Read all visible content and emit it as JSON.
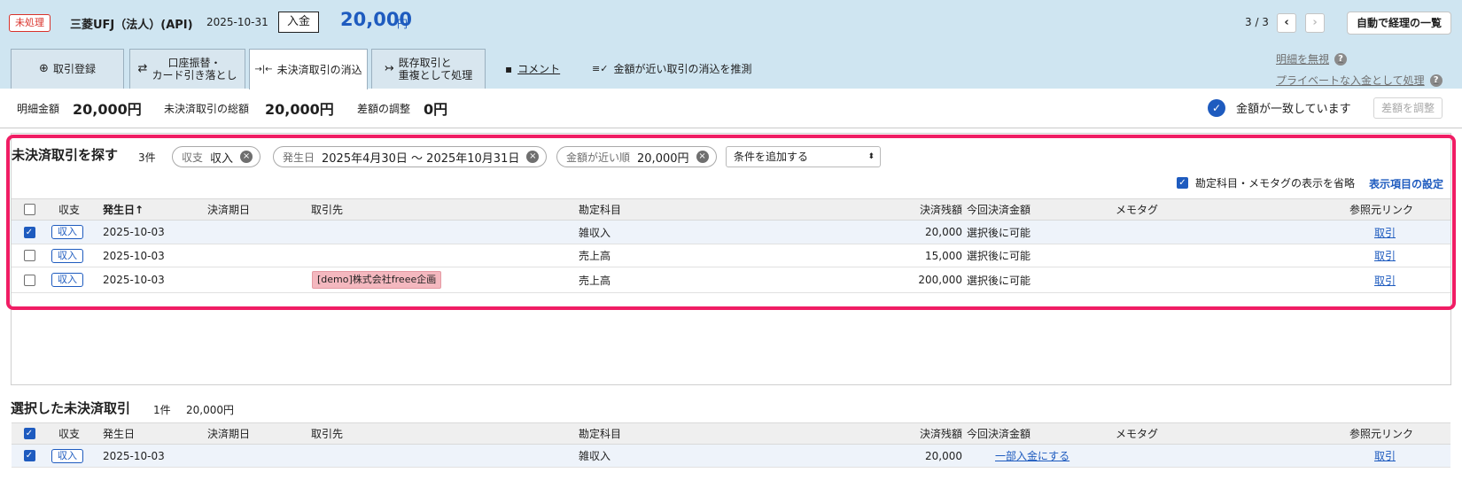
{
  "header": {
    "status_badge": "未処理",
    "bank_name": "三菱UFJ（法人）(API)",
    "date": "2025-10-31",
    "type": "入金",
    "amount": "20,000",
    "amount_unit": "円",
    "pager": "3 / 3",
    "prev_glyph": "‹",
    "next_glyph": "›",
    "auto_list_label": "自動で経理の一覧"
  },
  "tabs": [
    {
      "label": "取引登録",
      "icon": "⊕"
    },
    {
      "label1": "口座振替・",
      "label2": "カード引き落とし",
      "icon": "⇄"
    },
    {
      "label": "未決済取引の消込",
      "icon": "→|←"
    },
    {
      "label1": "既存取引と",
      "label2": "重複として処理",
      "icon": "↣"
    }
  ],
  "links": {
    "comment": "コメント",
    "comment_icon": "▪",
    "suggest": "金額が近い取引の消込を推測",
    "suggest_icon": "≡✓",
    "ignore": "明細を無視",
    "private_income": "プライベートな入金として処理",
    "help_glyph": "?"
  },
  "summary": {
    "detail_label": "明細金額",
    "detail_value": "20,000円",
    "unsettled_total_label": "未決済取引の総額",
    "unsettled_total_value": "20,000円",
    "diff_label": "差額の調整",
    "diff_value": "0円",
    "match_text": "金額が一致しています",
    "match_glyph": "✓",
    "adjust_label": "差額を調整"
  },
  "search": {
    "title": "未決済取引を探す",
    "count": "3件",
    "chips": [
      {
        "key": "収支",
        "value": "収入"
      },
      {
        "key": "発生日",
        "value": "2025年4月30日 ～ 2025年10月31日"
      },
      {
        "key": "金額が近い順",
        "value": "20,000円"
      }
    ],
    "chip_remove_glyph": "×",
    "add_condition": "条件を追加する",
    "select_arrow": "⬍",
    "omit_label": "勘定科目・メモタグの表示を省略",
    "display_settings": "表示項目の設定",
    "check_glyph": "✓",
    "columns": {
      "type": "収支",
      "date": "発生日",
      "sort_glyph": "↑",
      "due": "決済期日",
      "partner": "取引先",
      "account": "勘定科目",
      "balance": "決済残額",
      "current": "今回決済金額",
      "memo": "メモタグ",
      "ref": "参照元リンク"
    },
    "rows": [
      {
        "type": "収入",
        "date": "2025-10-03",
        "partner": "",
        "account": "雑収入",
        "balance": "20,000",
        "current": "選択後に可能",
        "ref": "取引"
      },
      {
        "type": "収入",
        "date": "2025-10-03",
        "partner": "",
        "account": "売上高",
        "balance": "15,000",
        "current": "選択後に可能",
        "ref": "取引"
      },
      {
        "type": "収入",
        "date": "2025-10-03",
        "partner": "[demo]株式会社freee企画",
        "account": "売上高",
        "balance": "200,000",
        "current": "選択後に可能",
        "ref": "取引"
      }
    ]
  },
  "selected": {
    "title": "選択した未決済取引",
    "count": "1件",
    "total": "20,000円",
    "row": {
      "type": "収入",
      "date": "2025-10-03",
      "account": "雑収入",
      "balance": "20,000",
      "current": "一部入金にする",
      "ref": "取引"
    }
  }
}
